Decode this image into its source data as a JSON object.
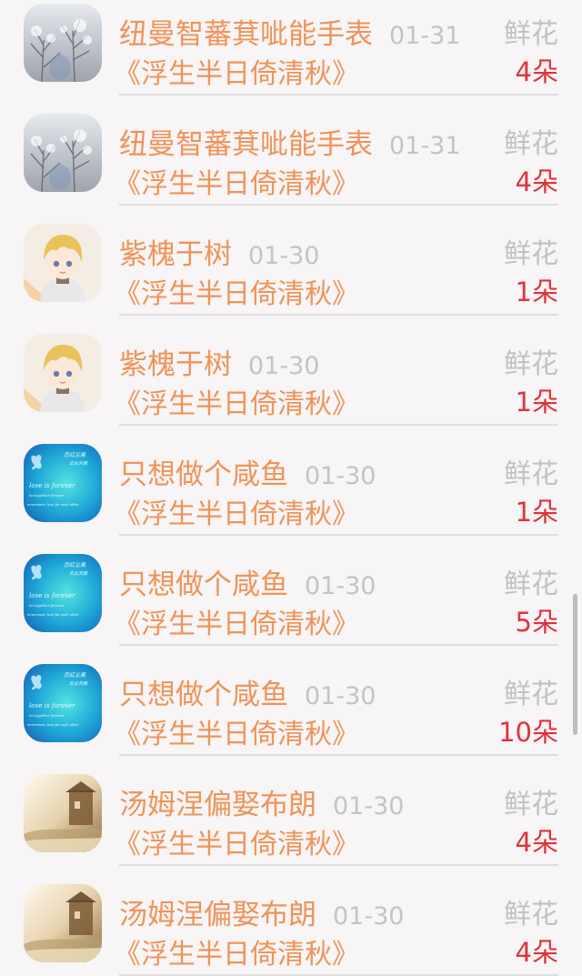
{
  "gift_records": [
    {
      "sender": "纽曼智蕃萁呲能手表",
      "date": "01-31",
      "book": "《浮生半日倚清秋》",
      "gift": "鲜花",
      "count": "4朵",
      "avatar": "winter-tree"
    },
    {
      "sender": "纽曼智蕃萁呲能手表",
      "date": "01-31",
      "book": "《浮生半日倚清秋》",
      "gift": "鲜花",
      "count": "4朵",
      "avatar": "winter-tree"
    },
    {
      "sender": "紫槐于树",
      "date": "01-30",
      "book": "《浮生半日倚清秋》",
      "gift": "鲜花",
      "count": "1朵",
      "avatar": "anime-boy"
    },
    {
      "sender": "紫槐于树",
      "date": "01-30",
      "book": "《浮生半日倚清秋》",
      "gift": "鲜花",
      "count": "1朵",
      "avatar": "anime-boy"
    },
    {
      "sender": "只想做个咸鱼",
      "date": "01-30",
      "book": "《浮生半日倚清秋》",
      "gift": "鲜花",
      "count": "1朵",
      "avatar": "blue-butterfly"
    },
    {
      "sender": "只想做个咸鱼",
      "date": "01-30",
      "book": "《浮生半日倚清秋》",
      "gift": "鲜花",
      "count": "5朵",
      "avatar": "blue-butterfly"
    },
    {
      "sender": "只想做个咸鱼",
      "date": "01-30",
      "book": "《浮生半日倚清秋》",
      "gift": "鲜花",
      "count": "10朵",
      "avatar": "blue-butterfly"
    },
    {
      "sender": "汤姆涅偏娶布朗",
      "date": "01-30",
      "book": "《浮生半日倚清秋》",
      "gift": "鲜花",
      "count": "4朵",
      "avatar": "sepia-house"
    },
    {
      "sender": "汤姆涅偏娶布朗",
      "date": "01-30",
      "book": "《浮生半日倚清秋》",
      "gift": "鲜花",
      "count": "4朵",
      "avatar": "sepia-house"
    }
  ],
  "avatar_art": {
    "blue-butterfly": [
      "恋红尘离",
      "云从天赋",
      "love is forever",
      "to together forever",
      "nevermore, love for each other"
    ]
  },
  "colors": {
    "name_text": "#f0935a",
    "count_text": "#e0323c",
    "meta_text": "#c4c4c4",
    "background": "#f7f5f5"
  }
}
